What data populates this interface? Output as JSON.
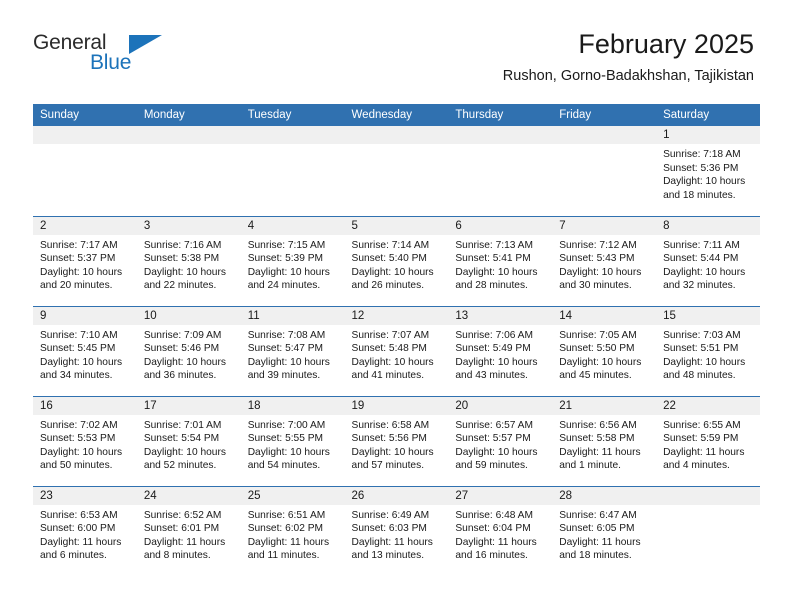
{
  "logo": {
    "word1": "General",
    "word2": "Blue",
    "triangle_color": "#1c73ba"
  },
  "header": {
    "title": "February 2025",
    "location": "Rushon, Gorno-Badakhshan, Tajikistan",
    "header_bg_color": "#3071b0"
  },
  "calendar": {
    "weekday_headers": [
      "Sunday",
      "Monday",
      "Tuesday",
      "Wednesday",
      "Thursday",
      "Friday",
      "Saturday"
    ],
    "weeks": [
      [
        {
          "empty": true
        },
        {
          "empty": true
        },
        {
          "empty": true
        },
        {
          "empty": true
        },
        {
          "empty": true
        },
        {
          "empty": true
        },
        {
          "day": "1",
          "sunrise": "Sunrise: 7:18 AM",
          "sunset": "Sunset: 5:36 PM",
          "daylight": "Daylight: 10 hours and 18 minutes."
        }
      ],
      [
        {
          "day": "2",
          "sunrise": "Sunrise: 7:17 AM",
          "sunset": "Sunset: 5:37 PM",
          "daylight": "Daylight: 10 hours and 20 minutes."
        },
        {
          "day": "3",
          "sunrise": "Sunrise: 7:16 AM",
          "sunset": "Sunset: 5:38 PM",
          "daylight": "Daylight: 10 hours and 22 minutes."
        },
        {
          "day": "4",
          "sunrise": "Sunrise: 7:15 AM",
          "sunset": "Sunset: 5:39 PM",
          "daylight": "Daylight: 10 hours and 24 minutes."
        },
        {
          "day": "5",
          "sunrise": "Sunrise: 7:14 AM",
          "sunset": "Sunset: 5:40 PM",
          "daylight": "Daylight: 10 hours and 26 minutes."
        },
        {
          "day": "6",
          "sunrise": "Sunrise: 7:13 AM",
          "sunset": "Sunset: 5:41 PM",
          "daylight": "Daylight: 10 hours and 28 minutes."
        },
        {
          "day": "7",
          "sunrise": "Sunrise: 7:12 AM",
          "sunset": "Sunset: 5:43 PM",
          "daylight": "Daylight: 10 hours and 30 minutes."
        },
        {
          "day": "8",
          "sunrise": "Sunrise: 7:11 AM",
          "sunset": "Sunset: 5:44 PM",
          "daylight": "Daylight: 10 hours and 32 minutes."
        }
      ],
      [
        {
          "day": "9",
          "sunrise": "Sunrise: 7:10 AM",
          "sunset": "Sunset: 5:45 PM",
          "daylight": "Daylight: 10 hours and 34 minutes."
        },
        {
          "day": "10",
          "sunrise": "Sunrise: 7:09 AM",
          "sunset": "Sunset: 5:46 PM",
          "daylight": "Daylight: 10 hours and 36 minutes."
        },
        {
          "day": "11",
          "sunrise": "Sunrise: 7:08 AM",
          "sunset": "Sunset: 5:47 PM",
          "daylight": "Daylight: 10 hours and 39 minutes."
        },
        {
          "day": "12",
          "sunrise": "Sunrise: 7:07 AM",
          "sunset": "Sunset: 5:48 PM",
          "daylight": "Daylight: 10 hours and 41 minutes."
        },
        {
          "day": "13",
          "sunrise": "Sunrise: 7:06 AM",
          "sunset": "Sunset: 5:49 PM",
          "daylight": "Daylight: 10 hours and 43 minutes."
        },
        {
          "day": "14",
          "sunrise": "Sunrise: 7:05 AM",
          "sunset": "Sunset: 5:50 PM",
          "daylight": "Daylight: 10 hours and 45 minutes."
        },
        {
          "day": "15",
          "sunrise": "Sunrise: 7:03 AM",
          "sunset": "Sunset: 5:51 PM",
          "daylight": "Daylight: 10 hours and 48 minutes."
        }
      ],
      [
        {
          "day": "16",
          "sunrise": "Sunrise: 7:02 AM",
          "sunset": "Sunset: 5:53 PM",
          "daylight": "Daylight: 10 hours and 50 minutes."
        },
        {
          "day": "17",
          "sunrise": "Sunrise: 7:01 AM",
          "sunset": "Sunset: 5:54 PM",
          "daylight": "Daylight: 10 hours and 52 minutes."
        },
        {
          "day": "18",
          "sunrise": "Sunrise: 7:00 AM",
          "sunset": "Sunset: 5:55 PM",
          "daylight": "Daylight: 10 hours and 54 minutes."
        },
        {
          "day": "19",
          "sunrise": "Sunrise: 6:58 AM",
          "sunset": "Sunset: 5:56 PM",
          "daylight": "Daylight: 10 hours and 57 minutes."
        },
        {
          "day": "20",
          "sunrise": "Sunrise: 6:57 AM",
          "sunset": "Sunset: 5:57 PM",
          "daylight": "Daylight: 10 hours and 59 minutes."
        },
        {
          "day": "21",
          "sunrise": "Sunrise: 6:56 AM",
          "sunset": "Sunset: 5:58 PM",
          "daylight": "Daylight: 11 hours and 1 minute."
        },
        {
          "day": "22",
          "sunrise": "Sunrise: 6:55 AM",
          "sunset": "Sunset: 5:59 PM",
          "daylight": "Daylight: 11 hours and 4 minutes."
        }
      ],
      [
        {
          "day": "23",
          "sunrise": "Sunrise: 6:53 AM",
          "sunset": "Sunset: 6:00 PM",
          "daylight": "Daylight: 11 hours and 6 minutes."
        },
        {
          "day": "24",
          "sunrise": "Sunrise: 6:52 AM",
          "sunset": "Sunset: 6:01 PM",
          "daylight": "Daylight: 11 hours and 8 minutes."
        },
        {
          "day": "25",
          "sunrise": "Sunrise: 6:51 AM",
          "sunset": "Sunset: 6:02 PM",
          "daylight": "Daylight: 11 hours and 11 minutes."
        },
        {
          "day": "26",
          "sunrise": "Sunrise: 6:49 AM",
          "sunset": "Sunset: 6:03 PM",
          "daylight": "Daylight: 11 hours and 13 minutes."
        },
        {
          "day": "27",
          "sunrise": "Sunrise: 6:48 AM",
          "sunset": "Sunset: 6:04 PM",
          "daylight": "Daylight: 11 hours and 16 minutes."
        },
        {
          "day": "28",
          "sunrise": "Sunrise: 6:47 AM",
          "sunset": "Sunset: 6:05 PM",
          "daylight": "Daylight: 11 hours and 18 minutes."
        },
        {
          "empty": true
        }
      ]
    ]
  }
}
